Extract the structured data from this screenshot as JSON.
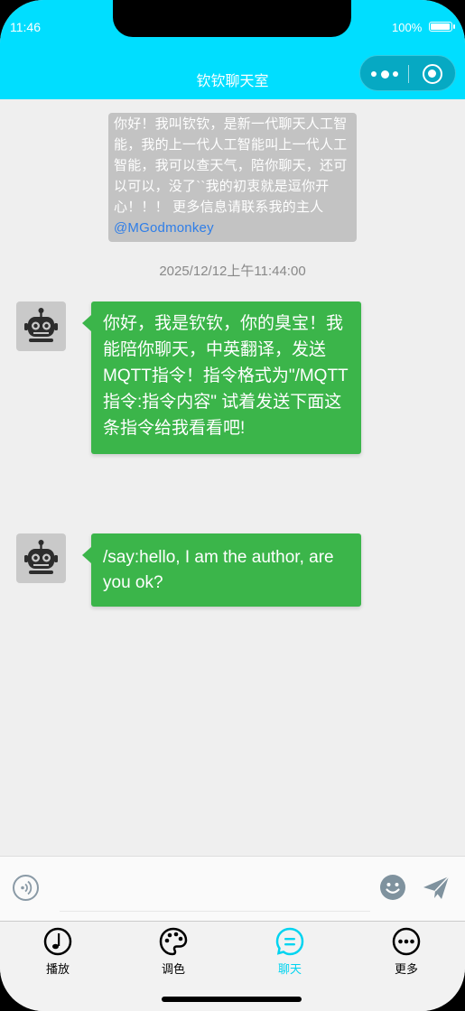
{
  "status": {
    "time": "11:46",
    "battery": "100%"
  },
  "header": {
    "title": "钦钦聊天室"
  },
  "intro": {
    "text": "你好！我叫钦钦，是新一代聊天人工智能，我的上一代人工智能叫上一代人工智能，我可以查天气，陪你聊天，还可以可以，没了``我的初衷就是逗你开心！！！ 更多信息请联系我的主人 ",
    "link": "@MGodmonkey"
  },
  "timestamp": "2025/12/12上午11:44:00",
  "messages": [
    {
      "text": "你好，我是钦钦，你的臭宝！我能陪你聊天，中英翻译，发送MQTT指令！指令格式为\"/MQTT指令:指令内容\" 试着发送下面这条指令给我看看吧!"
    },
    {
      "text": "/say:hello, I am the author, are you ok?"
    }
  ],
  "input": {
    "placeholder": ""
  },
  "tabs": [
    {
      "label": "播放",
      "icon": "music-note-icon"
    },
    {
      "label": "调色",
      "icon": "palette-icon"
    },
    {
      "label": "聊天",
      "icon": "chat-icon",
      "active": true
    },
    {
      "label": "更多",
      "icon": "more-icon"
    }
  ],
  "colors": {
    "accent": "#00deff",
    "bubble": "#3bb54a",
    "active_tab": "#00d4f0",
    "link": "#2f7ee8"
  }
}
